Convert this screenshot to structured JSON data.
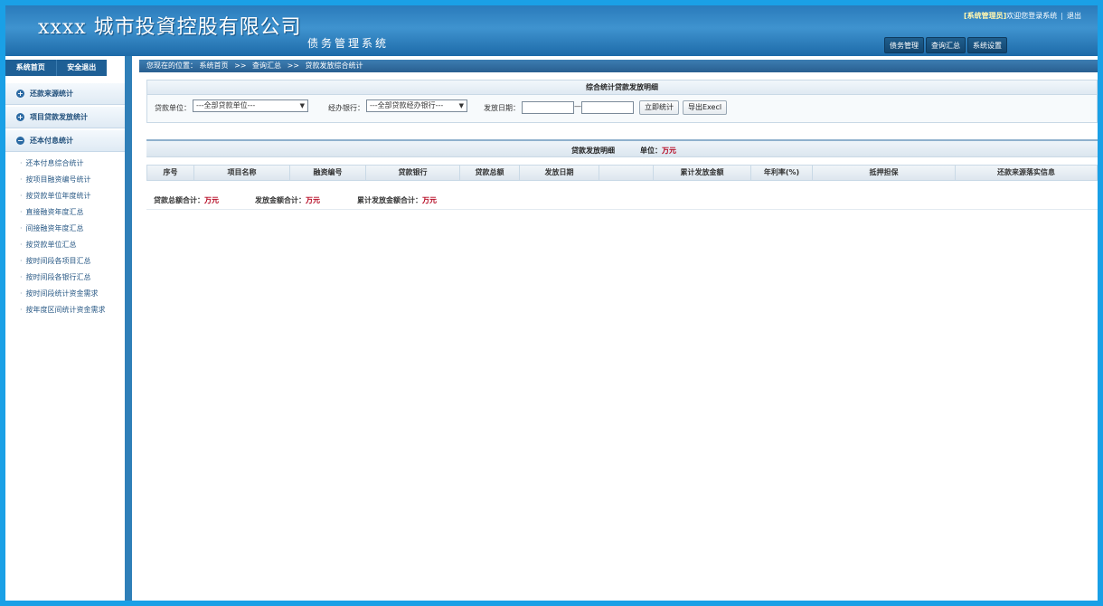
{
  "header": {
    "company_title": "xxxx 城市投資控股有限公司",
    "system_name": "债务管理系统",
    "user_role": "[系统管理员]",
    "welcome_text": "欢迎您登录系统",
    "separator": "|",
    "logout_label": "退出",
    "tabs": [
      "债务管理",
      "查询汇总",
      "系统设置"
    ]
  },
  "sidebar": {
    "home_label": "系统首页",
    "safe_exit_label": "安全退出",
    "groups": [
      {
        "label": "还款来源统计",
        "icon": "plus-circle-icon",
        "symbol": "+"
      },
      {
        "label": "项目贷款发放统计",
        "icon": "plus-circle-icon",
        "symbol": "+"
      },
      {
        "label": "还本付息统计",
        "icon": "minus-circle-icon",
        "symbol": "−"
      }
    ],
    "items": [
      "还本付息综合统计",
      "按项目融资编号统计",
      "按贷款单位年度统计",
      "直接融资年度汇总",
      "间接融资年度汇总",
      "按贷款单位汇总",
      "按时间段各项目汇总",
      "按时间段各银行汇总",
      "按时间段统计资金需求",
      "按年度区间统计资金需求"
    ],
    "item_bullet": "·"
  },
  "breadcrumb": {
    "prefix": "您现在的位置：",
    "crumbs": [
      "系统首页",
      "查询汇总",
      "贷款发放综合统计"
    ],
    "arrow": ">>"
  },
  "search_panel": {
    "title": "综合统计贷款发放明细",
    "loan_unit_label": "贷款单位：",
    "loan_unit_value": "---全部贷款单位---",
    "bank_label": "经办银行：",
    "bank_value": "---全部贷款经办银行---",
    "date_label": "发放日期：",
    "date_from": "",
    "date_to": "",
    "date_dash": "—",
    "stat_button": "立即统计",
    "export_button": "导出Execl"
  },
  "result": {
    "title": "贷款发放明细",
    "unit_label": "单位：",
    "unit_value": "万元",
    "columns": [
      "序号",
      "项目名称",
      "融资编号",
      "贷款银行",
      "贷款总额",
      "发放日期",
      "",
      "累计发放金额",
      "年利率(%)",
      "抵押担保",
      "还款来源落实信息"
    ],
    "totals": {
      "loan_total_label": "贷款总额合计：",
      "loan_total_value": "万元",
      "issued_total_label": "发放金额合计：",
      "issued_total_value": "万元",
      "cumulative_total_label": "累计发放金额合计：",
      "cumulative_total_value": "万元"
    }
  },
  "colors": {
    "frame": "#1aa0e6",
    "header": "#2a7bbb",
    "accent_red": "#b3001b"
  }
}
